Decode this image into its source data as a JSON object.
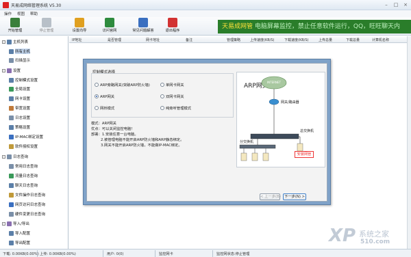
{
  "window": {
    "title": "天易成网络管理系统 V5.30"
  },
  "menu": [
    "操作",
    "视图",
    "帮助"
  ],
  "toolbar": {
    "buttons": [
      {
        "label": "开始管理",
        "icon": "monitor-icon",
        "color": "#3a7f3a"
      },
      {
        "label": "停止管理",
        "icon": "stop-icon",
        "color": "#b8c0c8"
      },
      {
        "label": "设置向导",
        "icon": "wand-icon",
        "color": "#e0a020"
      },
      {
        "label": "访问官网",
        "icon": "home-icon",
        "color": "#2e8b3e"
      },
      {
        "label": "常见问题解答",
        "icon": "help-icon",
        "color": "#3a6fc0"
      },
      {
        "label": "退出程序",
        "icon": "exit-icon",
        "color": "#d23232"
      }
    ]
  },
  "banner": {
    "brand": "天易成网管",
    "text": "电脑屏幕监控，禁止任意软件运行，QQ，旺旺聊天内"
  },
  "sidebar": {
    "items": [
      {
        "label": "主机列表",
        "level": 0,
        "icon": "computer-icon"
      },
      {
        "label": "所有主机",
        "level": 1,
        "icon": "computer-icon",
        "selected": true
      },
      {
        "label": "扫描显示",
        "level": 1,
        "icon": "scan-icon"
      },
      {
        "label": "设置",
        "level": 0,
        "icon": "settings-icon"
      },
      {
        "label": "控制模式设置",
        "level": 1,
        "icon": "mode-icon"
      },
      {
        "label": "全局设置",
        "level": 1,
        "icon": "globe-icon"
      },
      {
        "label": "网卡设置",
        "level": 1,
        "icon": "nic-icon"
      },
      {
        "label": "带宽设置",
        "level": 1,
        "icon": "bandwidth-icon"
      },
      {
        "label": "日志设置",
        "level": 1,
        "icon": "log-icon"
      },
      {
        "label": "策略设置",
        "level": 1,
        "icon": "policy-icon"
      },
      {
        "label": "IP-MAC绑定设置",
        "level": 1,
        "icon": "bind-icon"
      },
      {
        "label": "软件授权设置",
        "level": 1,
        "icon": "license-icon"
      },
      {
        "label": "日志查询",
        "level": 0,
        "icon": "query-icon"
      },
      {
        "label": "常用日志查询",
        "level": 1,
        "icon": "log-icon"
      },
      {
        "label": "流量日志查询",
        "level": 1,
        "icon": "traffic-icon"
      },
      {
        "label": "聊天日志查询",
        "level": 1,
        "icon": "chat-icon"
      },
      {
        "label": "文件操作日志查询",
        "level": 1,
        "icon": "file-icon"
      },
      {
        "label": "网页访问日志查询",
        "level": 1,
        "icon": "web-icon"
      },
      {
        "label": "硬件变更日志查询",
        "level": 1,
        "icon": "hardware-icon"
      },
      {
        "label": "导入/导出",
        "level": 0,
        "icon": "import-export-icon"
      },
      {
        "label": "导入配置",
        "level": 1,
        "icon": "import-icon"
      },
      {
        "label": "导出配置",
        "level": 1,
        "icon": "export-icon"
      }
    ]
  },
  "grid": {
    "columns": [
      "IP地址",
      "是否管理",
      "网卡地址",
      "备注",
      "管理策略",
      "上传速度(KB/S)",
      "下载速度(KB/S)",
      "上传总量",
      "下载总量",
      "计算机名称"
    ]
  },
  "dialog": {
    "group_title": "控制模式选择",
    "options": [
      {
        "label": "ARP旁路网关(突破ARP防火墙)",
        "selected": false
      },
      {
        "label": "单网卡网关",
        "selected": false
      },
      {
        "label": "ARP网关",
        "selected": true
      },
      {
        "label": "双网卡网关",
        "selected": false
      },
      {
        "label": "网桥模式",
        "selected": false
      },
      {
        "label": "纯旁听管理模式",
        "selected": false
      }
    ],
    "description": [
      "模式：ARP网关",
      "优点：可以关闭监控电脑！",
      "部署：1.安装任意一台电脑。",
      "      2.被管理电脑不能开启ARP防火墙和ARP静态绑定。",
      "      3.网关不能开启ARP防火墙，不能做IP-MAC绑定。"
    ],
    "diagram": {
      "title": "ARP网关",
      "internet_label": "INTERNET",
      "router_label": "网关/路由器",
      "core_switch_label": "总交换机",
      "branch_switch_label": "分交换机",
      "install_label": "安装网管"
    },
    "back_button": "< 上一步(B)",
    "next_button": "下一步(N) >"
  },
  "status": {
    "download": "下载: 0.00KB(0.00%)",
    "upload": "上传: 0.00KB(0.00%)",
    "users": "用户: 0(0)",
    "monitor_net": "监控网卡",
    "monitor_state": "监控网状态:停止管理"
  },
  "watermark": {
    "big": "XP",
    "cn": "系统之家",
    "site": "510.com"
  },
  "colors": {
    "accent": "#2a7d2a",
    "highlight": "#ffe23a",
    "dialog_frame": "#7fa2c8",
    "install_red": "#e33333"
  }
}
